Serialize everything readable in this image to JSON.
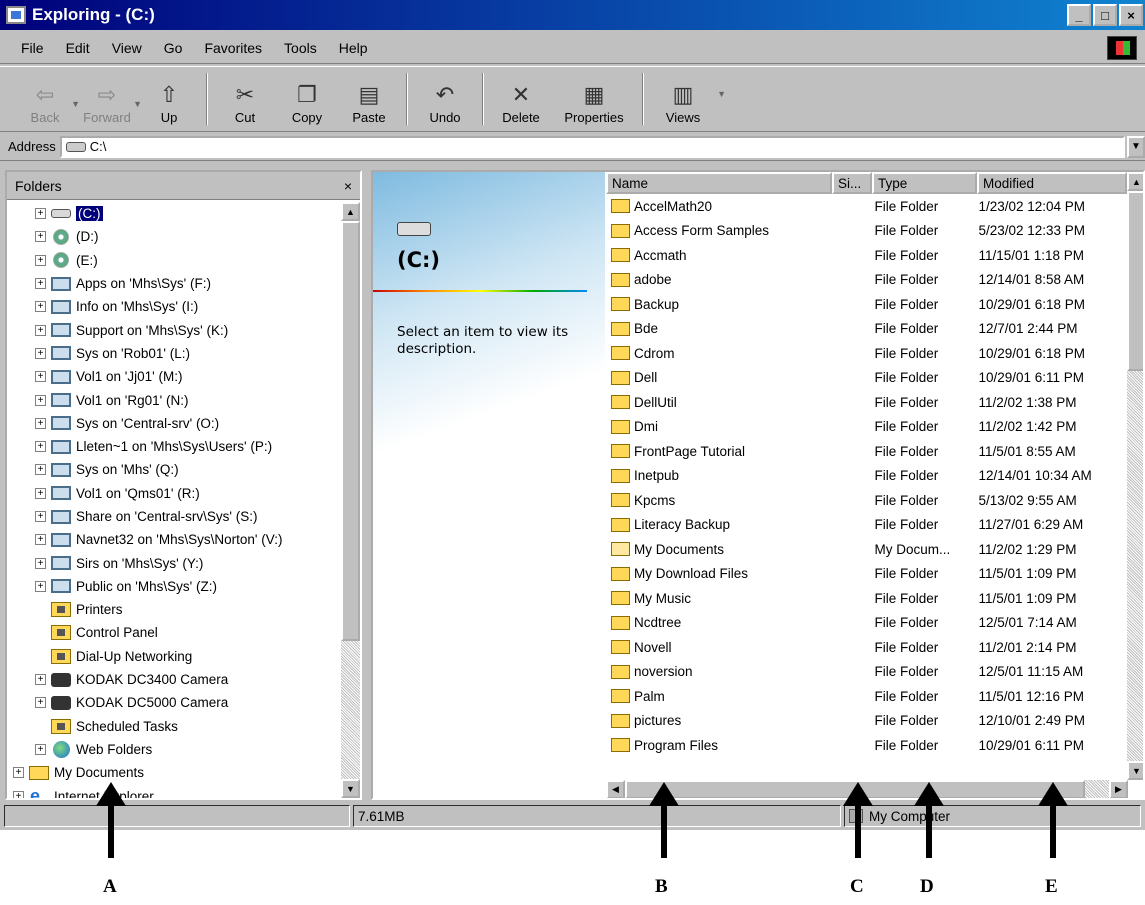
{
  "window": {
    "title": "Exploring - (C:)",
    "buttons": {
      "minimize": "_",
      "maximize": "□",
      "close": "×"
    }
  },
  "menu": [
    "File",
    "Edit",
    "View",
    "Go",
    "Favorites",
    "Tools",
    "Help"
  ],
  "toolbar": [
    {
      "label": "Back",
      "icon": "back-arrow-icon",
      "enabled": false
    },
    {
      "label": "Forward",
      "icon": "forward-arrow-icon",
      "enabled": false
    },
    {
      "label": "Up",
      "icon": "up-folder-icon",
      "enabled": true
    },
    {
      "label": "Cut",
      "icon": "scissors-icon",
      "enabled": true
    },
    {
      "label": "Copy",
      "icon": "copy-icon",
      "enabled": true
    },
    {
      "label": "Paste",
      "icon": "paste-icon",
      "enabled": true
    },
    {
      "label": "Undo",
      "icon": "undo-icon",
      "enabled": true
    },
    {
      "label": "Delete",
      "icon": "delete-x-icon",
      "enabled": true
    },
    {
      "label": "Properties",
      "icon": "properties-icon",
      "enabled": true
    },
    {
      "label": "Views",
      "icon": "views-icon",
      "enabled": true
    }
  ],
  "address": {
    "label": "Address",
    "value": "C:\\"
  },
  "folders": {
    "title": "Folders",
    "close": "×",
    "items": [
      {
        "label": "(C:)",
        "icon": "drive-icon",
        "selected": true
      },
      {
        "label": "(D:)",
        "icon": "cd-drive-icon"
      },
      {
        "label": "(E:)",
        "icon": "cd-drive-icon"
      },
      {
        "label": "Apps on 'Mhs\\Sys' (F:)",
        "icon": "network-drive-icon"
      },
      {
        "label": "Info on 'Mhs\\Sys' (I:)",
        "icon": "network-drive-icon"
      },
      {
        "label": "Support on 'Mhs\\Sys' (K:)",
        "icon": "network-drive-icon"
      },
      {
        "label": "Sys on 'Rob01' (L:)",
        "icon": "network-drive-icon"
      },
      {
        "label": "Vol1 on 'Jj01' (M:)",
        "icon": "network-drive-icon"
      },
      {
        "label": "Vol1 on 'Rg01' (N:)",
        "icon": "network-drive-icon"
      },
      {
        "label": "Sys on 'Central-srv' (O:)",
        "icon": "network-drive-icon"
      },
      {
        "label": "Lleten~1 on 'Mhs\\Sys\\Users' (P:)",
        "icon": "network-drive-icon"
      },
      {
        "label": "Sys on 'Mhs' (Q:)",
        "icon": "network-drive-icon"
      },
      {
        "label": "Vol1 on 'Qms01' (R:)",
        "icon": "network-drive-icon"
      },
      {
        "label": "Share on 'Central-srv\\Sys' (S:)",
        "icon": "network-drive-icon"
      },
      {
        "label": "Navnet32 on 'Mhs\\Sys\\Norton' (V:)",
        "icon": "network-drive-icon"
      },
      {
        "label": "Sirs on 'Mhs\\Sys' (Y:)",
        "icon": "network-drive-icon"
      },
      {
        "label": "Public on 'Mhs\\Sys' (Z:)",
        "icon": "network-drive-icon"
      },
      {
        "label": "Printers",
        "icon": "printers-folder-icon",
        "leaf": true
      },
      {
        "label": "Control Panel",
        "icon": "control-panel-icon",
        "leaf": true
      },
      {
        "label": "Dial-Up Networking",
        "icon": "dialup-icon",
        "leaf": true
      },
      {
        "label": "KODAK DC3400 Camera",
        "icon": "camera-icon"
      },
      {
        "label": "KODAK DC5000 Camera",
        "icon": "camera-icon"
      },
      {
        "label": "Scheduled Tasks",
        "icon": "scheduled-tasks-icon",
        "leaf": true
      },
      {
        "label": "Web Folders",
        "icon": "web-folders-icon"
      },
      {
        "label": "My Documents",
        "icon": "my-documents-icon",
        "level": 0
      },
      {
        "label": "Internet Explorer",
        "icon": "internet-explorer-icon",
        "level": 0
      }
    ]
  },
  "webview": {
    "title": "(C:)",
    "description": "Select an item to view its description."
  },
  "list": {
    "columns": [
      "Name",
      "Si...",
      "Type",
      "Modified"
    ],
    "rows": [
      [
        "AccelMath20",
        "File Folder",
        "1/23/02 12:04 PM"
      ],
      [
        "Access Form Samples",
        "File Folder",
        "5/23/02 12:33 PM"
      ],
      [
        "Accmath",
        "File Folder",
        "11/15/01 1:18 PM"
      ],
      [
        "adobe",
        "File Folder",
        "12/14/01 8:58 AM"
      ],
      [
        "Backup",
        "File Folder",
        "10/29/01 6:18 PM"
      ],
      [
        "Bde",
        "File Folder",
        "12/7/01 2:44 PM"
      ],
      [
        "Cdrom",
        "File Folder",
        "10/29/01 6:18 PM"
      ],
      [
        "Dell",
        "File Folder",
        "10/29/01 6:11 PM"
      ],
      [
        "DellUtil",
        "File Folder",
        "11/2/02 1:38 PM"
      ],
      [
        "Dmi",
        "File Folder",
        "11/2/02 1:42 PM"
      ],
      [
        "FrontPage Tutorial",
        "File Folder",
        "11/5/01 8:55 AM"
      ],
      [
        "Inetpub",
        "File Folder",
        "12/14/01 10:34 AM"
      ],
      [
        "Kpcms",
        "File Folder",
        "5/13/02 9:55 AM"
      ],
      [
        "Literacy Backup",
        "File Folder",
        "11/27/01 6:29 AM"
      ],
      [
        "My Documents",
        "My Docum...",
        "11/2/02 1:29 PM"
      ],
      [
        "My Download Files",
        "File Folder",
        "11/5/01 1:09 PM"
      ],
      [
        "My Music",
        "File Folder",
        "11/5/01 1:09 PM"
      ],
      [
        "Ncdtree",
        "File Folder",
        "12/5/01 7:14 AM"
      ],
      [
        "Novell",
        "File Folder",
        "11/2/01 2:14 PM"
      ],
      [
        "noversion",
        "File Folder",
        "12/5/01 11:15 AM"
      ],
      [
        "Palm",
        "File Folder",
        "11/5/01 12:16 PM"
      ],
      [
        "pictures",
        "File Folder",
        "12/10/01 2:49 PM"
      ],
      [
        "Program Files",
        "File Folder",
        "10/29/01 6:11 PM"
      ]
    ]
  },
  "status": {
    "left": "",
    "size": "7.61MB",
    "location": "My Computer"
  },
  "annotations": [
    "A",
    "B",
    "C",
    "D",
    "E"
  ],
  "colors": {
    "titlebar": "#00007b",
    "selection": "#00007b",
    "face": "#c0c0c0",
    "folder": "#ffd85a"
  }
}
